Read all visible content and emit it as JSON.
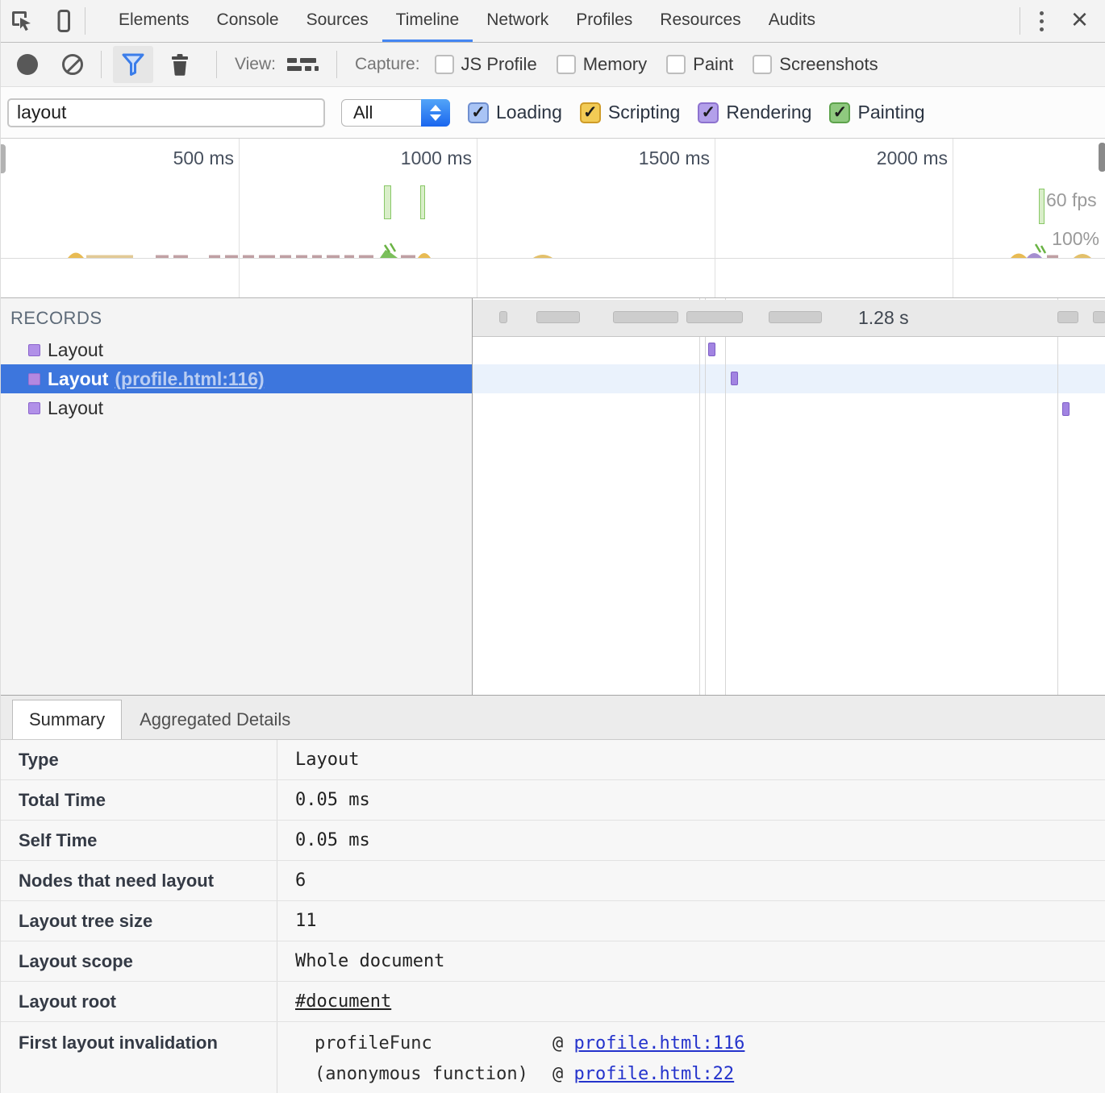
{
  "colors": {
    "accent_blue": "#4486f2",
    "selection_blue": "#3d76dd",
    "loading": "#a9c4f5",
    "scripting": "#f2cb55",
    "rendering": "#b3a0ea",
    "painting": "#8fc97f",
    "event_purple": "#a284e2",
    "fps_green": "#89c867",
    "link_blue": "#2433cc"
  },
  "tabbar": {
    "tabs": [
      {
        "label": "Elements"
      },
      {
        "label": "Console"
      },
      {
        "label": "Sources"
      },
      {
        "label": "Timeline"
      },
      {
        "label": "Network"
      },
      {
        "label": "Profiles"
      },
      {
        "label": "Resources"
      },
      {
        "label": "Audits"
      }
    ],
    "close_glyph": "×"
  },
  "toolbar": {
    "view_label": "View:",
    "capture_label": "Capture:",
    "capture_options": [
      {
        "label": "JS Profile",
        "checked": false
      },
      {
        "label": "Memory",
        "checked": false
      },
      {
        "label": "Paint",
        "checked": false
      },
      {
        "label": "Screenshots",
        "checked": false
      }
    ]
  },
  "filterbar": {
    "filter_value": "layout",
    "category_value": "All",
    "check_glyph": "✓",
    "checkboxes": [
      {
        "label": "Loading",
        "checked": true
      },
      {
        "label": "Scripting",
        "checked": true
      },
      {
        "label": "Rendering",
        "checked": true
      },
      {
        "label": "Painting",
        "checked": true
      }
    ]
  },
  "overview": {
    "ticks": [
      "500 ms",
      "1000 ms",
      "1500 ms",
      "2000 ms"
    ],
    "fps_label": "60 fps",
    "percent_label": "100%"
  },
  "records": {
    "header": "RECORDS",
    "total_time_label": "1.28 s",
    "rows": [
      {
        "name": "Layout",
        "link": ""
      },
      {
        "name": "Layout",
        "link": "(profile.html:116)"
      },
      {
        "name": "Layout",
        "link": ""
      }
    ]
  },
  "details": {
    "tabs": [
      {
        "label": "Summary"
      },
      {
        "label": "Aggregated Details"
      }
    ],
    "rows": [
      {
        "label": "Type",
        "value": "Layout"
      },
      {
        "label": "Total Time",
        "value": "0.05 ms"
      },
      {
        "label": "Self Time",
        "value": "0.05 ms"
      },
      {
        "label": "Nodes that need layout",
        "value": "6"
      },
      {
        "label": "Layout tree size",
        "value": "11"
      },
      {
        "label": "Layout scope",
        "value": "Whole document"
      },
      {
        "label": "Layout root",
        "value": "#document"
      },
      {
        "label": "First layout invalidation",
        "value": ""
      }
    ],
    "stack": [
      {
        "func": "profileFunc",
        "sep": "@ ",
        "link": "profile.html:116"
      },
      {
        "func": "(anonymous function)",
        "sep": "@ ",
        "link": "profile.html:22"
      }
    ]
  }
}
